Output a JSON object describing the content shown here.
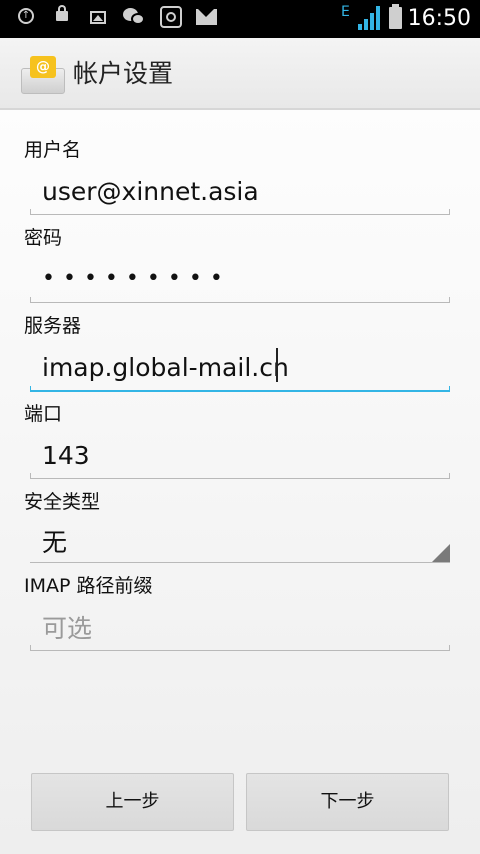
{
  "status_bar": {
    "network_type": "E",
    "time": "16:50",
    "icons": [
      "upload-icon",
      "lock-icon",
      "image-icon",
      "wechat-icon",
      "robot-icon",
      "mail-icon",
      "signal-icon",
      "battery-icon"
    ],
    "accent_color": "#33b5e5"
  },
  "action_bar": {
    "title": "帐户设置",
    "icon": "email-app-icon",
    "icon_symbol": "@"
  },
  "form": {
    "username": {
      "label": "用户名",
      "value": "user@xinnet.asia"
    },
    "password": {
      "label": "密码",
      "value": "•••••••••"
    },
    "server": {
      "label": "服务器",
      "value": "imap.global-mail.cn"
    },
    "port": {
      "label": "端口",
      "value": "143"
    },
    "security": {
      "label": "安全类型",
      "value": "无"
    },
    "path_prefix": {
      "label": "IMAP 路径前缀",
      "placeholder": "可选"
    }
  },
  "buttons": {
    "previous": "上一步",
    "next": "下一步"
  }
}
